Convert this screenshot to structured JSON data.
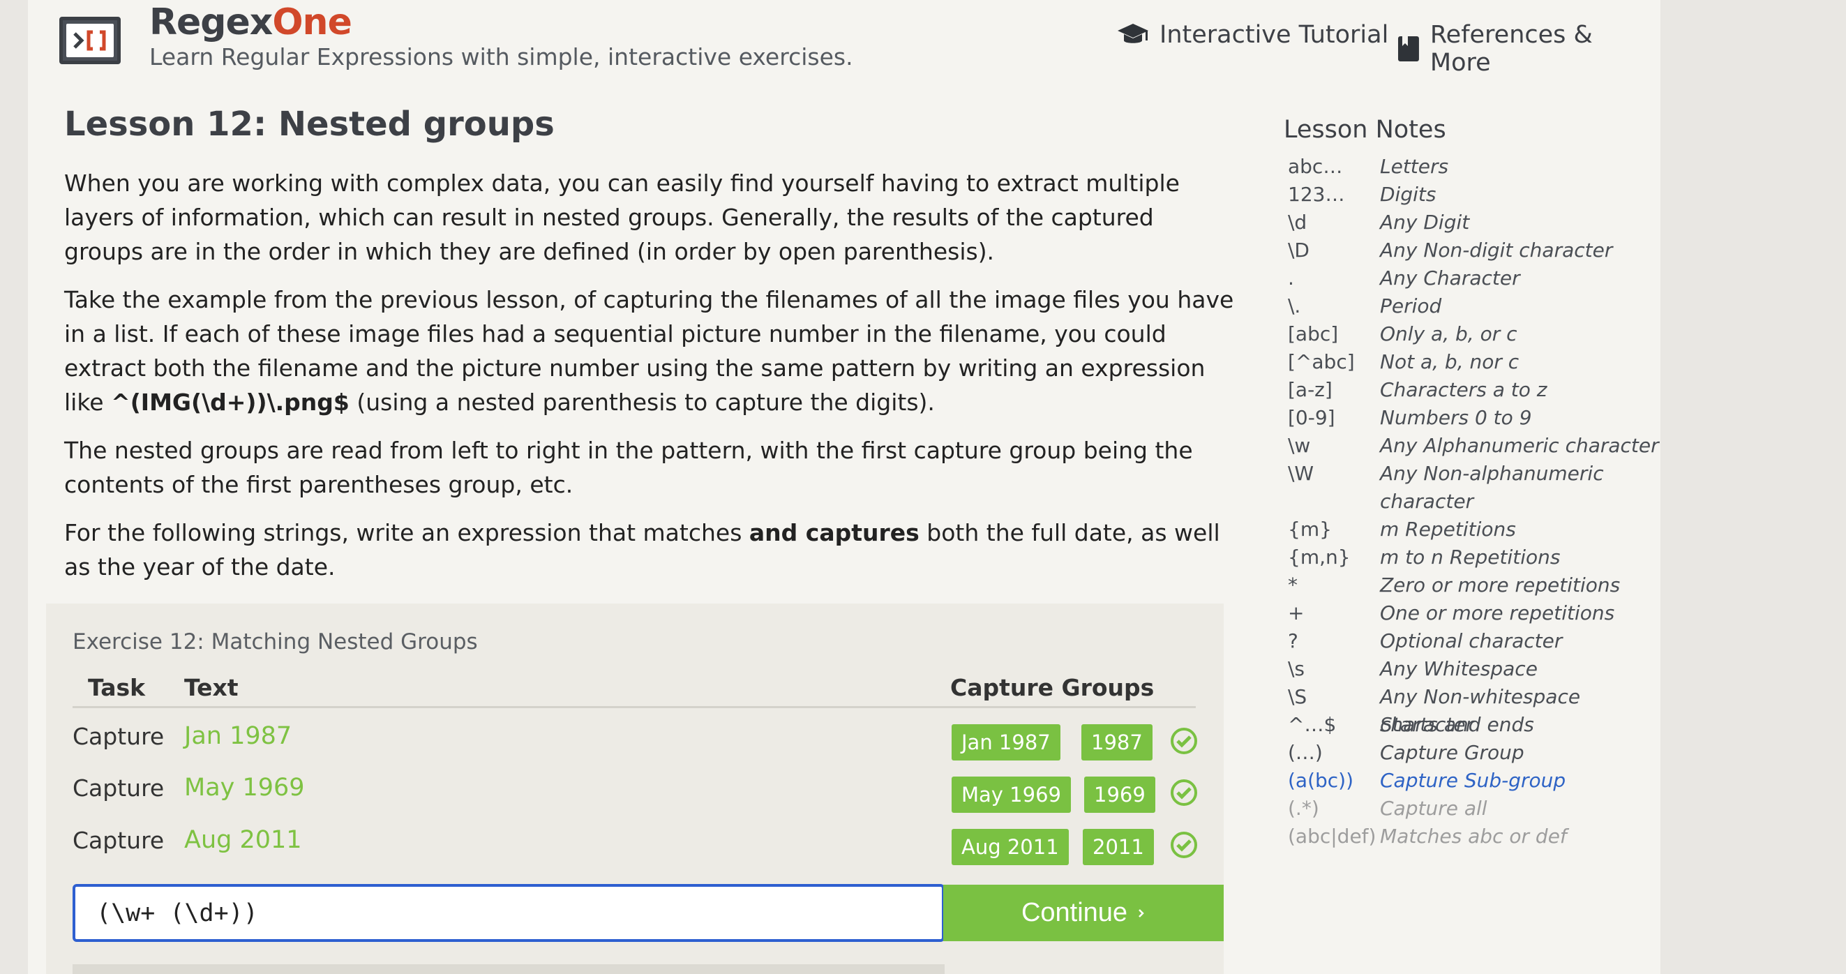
{
  "header": {
    "brand_main": "Regex",
    "brand_accent": "One",
    "tagline": "Learn Regular Expressions with simple, interactive exercises.",
    "nav": [
      {
        "label": "Interactive Tutorial",
        "icon": "graduation-cap-icon"
      },
      {
        "label": "References & More",
        "icon": "book-icon"
      }
    ]
  },
  "lesson": {
    "title": "Lesson 12: Nested groups",
    "p1": "When you are working with complex data, you can easily find yourself having to extract multiple layers of information, which can result in nested groups. Generally, the results of the captured groups are in the order in which they are defined (in order by open parenthesis).",
    "p2_before": "Take the example from the previous lesson, of capturing the filenames of all the image files you have in a list. If each of these image files had a sequential picture number in the filename, you could extract both the filename and the picture number using the same pattern by writing an expression like",
    "p2_code": "^(IMG(\\d+))\\.png$",
    "p2_after": " (using a nested parenthesis to capture the digits).",
    "p3": "The nested groups are read from left to right in the pattern, with the first capture group being the contents of the first parentheses group, etc.",
    "p4_before": "For the following strings, write an expression that matches ",
    "p4_bold": "and captures",
    "p4_after": " both the full date, as well as the year of the date."
  },
  "exercise": {
    "title": "Exercise 12: Matching Nested Groups",
    "headers": {
      "task": "Task",
      "text": "Text",
      "groups": "Capture Groups"
    },
    "rows": [
      {
        "task": "Capture",
        "text": "Jan 1987",
        "groups": [
          "Jan 1987",
          "1987"
        ],
        "status": "check-circle-icon"
      },
      {
        "task": "Capture",
        "text": "May 1969",
        "groups": [
          "May 1969",
          "1969"
        ],
        "status": "check-circle-icon"
      },
      {
        "task": "Capture",
        "text": "Aug 2011",
        "groups": [
          "Aug 2011",
          "2011"
        ],
        "status": "check-circle-icon"
      }
    ],
    "input_value": "(\\w+ (\\d+))",
    "continue_label": "Continue",
    "continue_icon": "chevron-right-icon"
  },
  "notes": {
    "title": "Lesson Notes",
    "items": [
      {
        "k": "abc…",
        "d": "Letters"
      },
      {
        "k": "123…",
        "d": "Digits"
      },
      {
        "k": "\\d",
        "d": "Any Digit"
      },
      {
        "k": "\\D",
        "d": "Any Non-digit character"
      },
      {
        "k": ".",
        "d": "Any Character"
      },
      {
        "k": "\\.",
        "d": "Period"
      },
      {
        "k": "[abc]",
        "d": "Only a, b, or c"
      },
      {
        "k": "[^abc]",
        "d": "Not a, b, nor c"
      },
      {
        "k": "[a-z]",
        "d": "Characters a to z"
      },
      {
        "k": "[0-9]",
        "d": "Numbers 0 to 9"
      },
      {
        "k": "\\w",
        "d": "Any Alphanumeric character"
      },
      {
        "k": "\\W",
        "d": "Any Non-alphanumeric"
      },
      {
        "k": "",
        "d": "character"
      },
      {
        "k": "{m}",
        "d": "m Repetitions"
      },
      {
        "k": "{m,n}",
        "d": "m to n Repetitions"
      },
      {
        "k": "*",
        "d": "Zero or more repetitions"
      },
      {
        "k": "+",
        "d": "One or more repetitions"
      },
      {
        "k": "?",
        "d": "Optional character"
      },
      {
        "k": "\\s",
        "d": "Any Whitespace"
      },
      {
        "k": "\\S",
        "d": "Any Non-whitespace character"
      },
      {
        "k": "^…$",
        "d": "Starts and ends"
      },
      {
        "k": "(…)",
        "d": "Capture Group"
      },
      {
        "k": "(a(bc))",
        "d": "Capture Sub-group"
      },
      {
        "k": "(.*)",
        "d": "Capture all"
      },
      {
        "k": "(abc|def)",
        "d": "Matches abc or def"
      }
    ]
  },
  "colors": {
    "accent_green": "#7ac142",
    "brand_orange": "#d1482a",
    "input_border": "#2e5fd0",
    "highlight_blue": "#2e63c5"
  }
}
